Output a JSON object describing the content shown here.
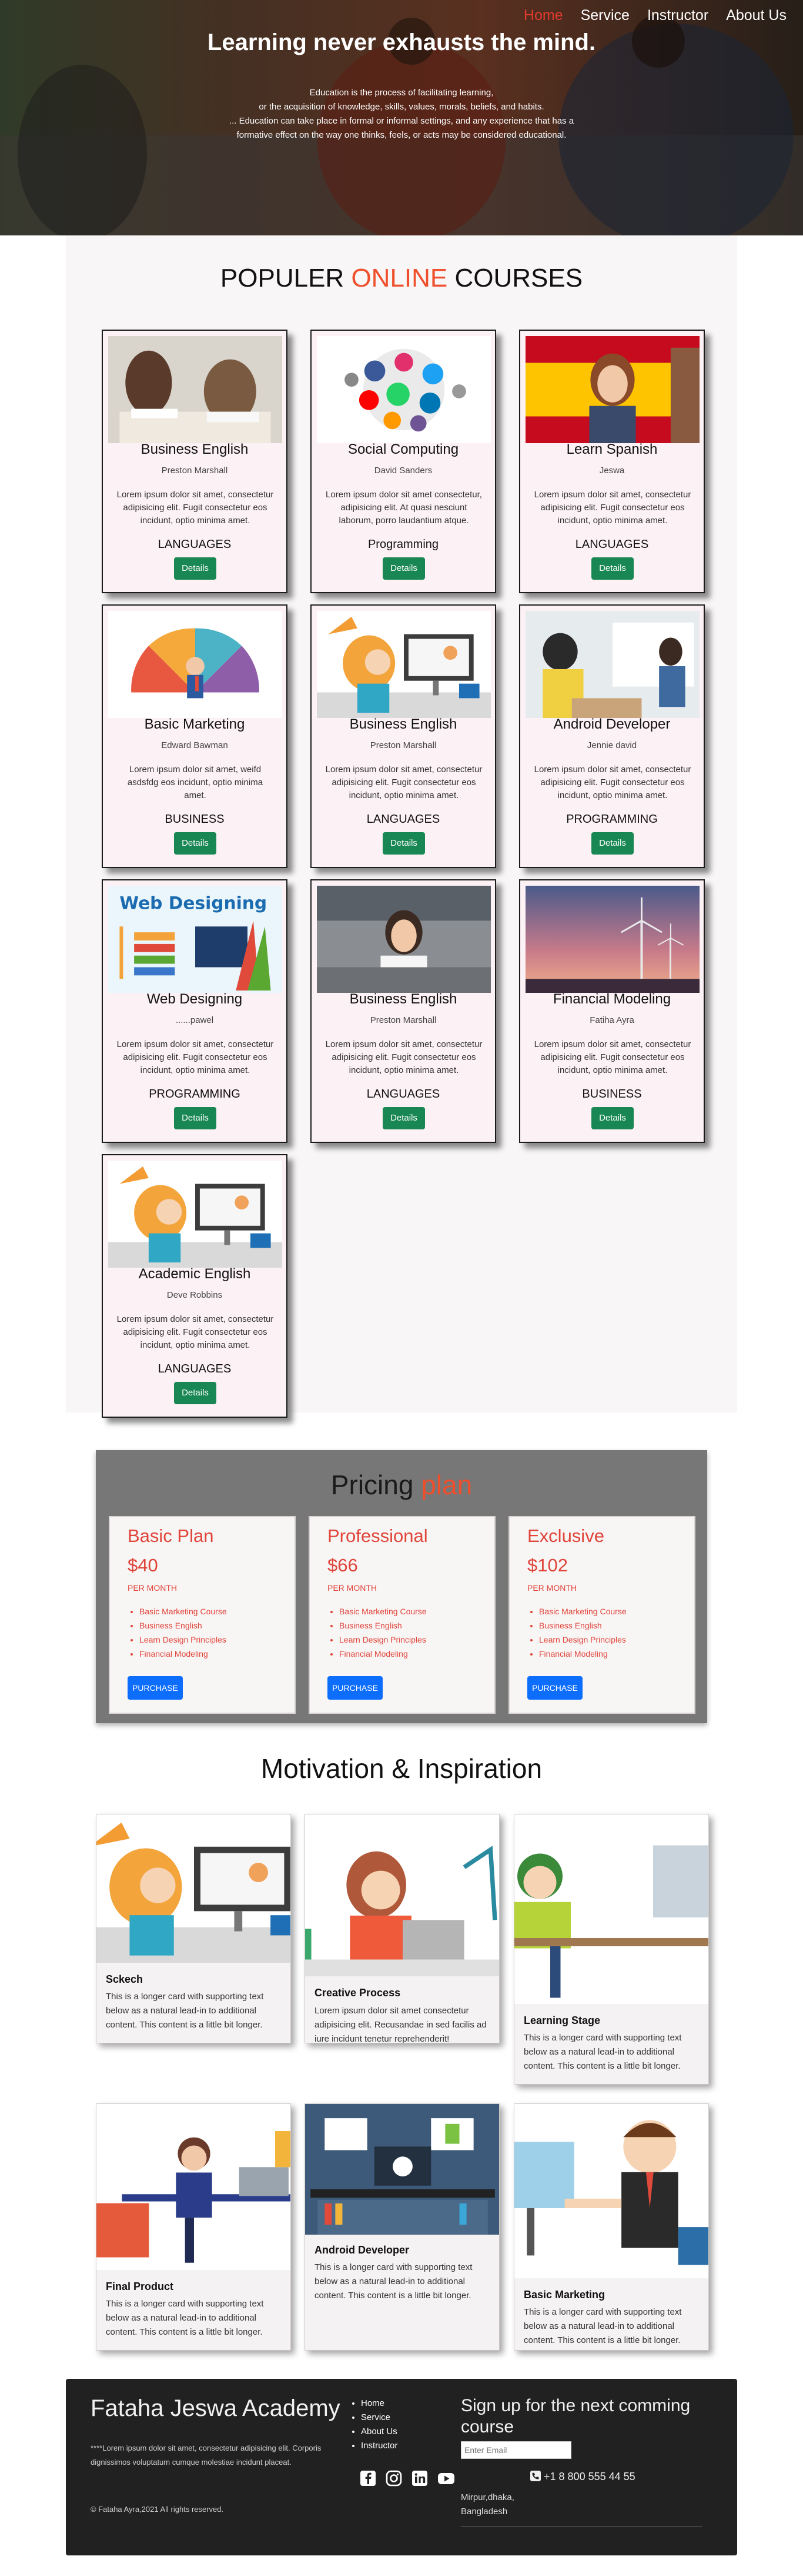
{
  "nav": {
    "items": [
      {
        "label": "Home"
      },
      {
        "label": "Service"
      },
      {
        "label": "Instructor"
      },
      {
        "label": "About Us"
      }
    ]
  },
  "hero": {
    "title": "Learning never exhausts the mind.",
    "line1": "Education is the process of facilitating learning,",
    "line2": "or the acquisition of knowledge, skills, values, morals, beliefs, and habits.",
    "line3": "... Education can take place in formal or informal settings, and any experience that has a",
    "line4": "formative effect on the way one thinks, feels, or acts may be considered educational."
  },
  "courses": {
    "title_part1": "POPULER",
    "title_accent": "ONLINE",
    "title_part2": "COURSES",
    "details_label": "Details",
    "items": [
      {
        "title": "Business English",
        "instructor": "Preston Marshall",
        "desc": "Lorem ipsum dolor sit amet, consectetur adipisicing elit. Fugit consectetur eos incidunt, optio minima amet.",
        "category": "LANGUAGES",
        "image": "students-studying-image"
      },
      {
        "title": "Social Computing",
        "instructor": "David Sanders",
        "desc": "Lorem ipsum dolor sit amet consectetur, adipisicing elit. At quasi nesciunt laborum, porro laudantium atque.",
        "category": "Programming",
        "image": "social-media-icons-image"
      },
      {
        "title": "Learn Spanish",
        "instructor": "Jeswa",
        "desc": "Lorem ipsum dolor sit amet, consectetur adipisicing elit. Fugit consectetur eos incidunt, optio minima amet.",
        "category": "LANGUAGES",
        "image": "spanish-flag-woman-image"
      },
      {
        "title": "Basic Marketing",
        "instructor": "Edward Bawman",
        "desc": "Lorem ipsum dolor sit amet, weifd asdsfdg eos incidunt, optio minima amet.",
        "category": "BUSINESS",
        "image": "marketing-wheel-image"
      },
      {
        "title": "Business English",
        "instructor": "Preston Marshall",
        "desc": "Lorem ipsum dolor sit amet, consectetur adipisicing elit. Fugit consectetur eos incidunt, optio minima amet.",
        "category": "LANGUAGES",
        "image": "girl-computer-illustration"
      },
      {
        "title": "Android Developer",
        "instructor": "Jennie david",
        "desc": "Lorem ipsum dolor sit amet, consectetur adipisicing elit. Fugit consectetur eos incidunt, optio minima amet.",
        "category": "PROGRAMMING",
        "image": "students-whiteboard-image"
      },
      {
        "title": "Web Designing",
        "instructor": "......pawel",
        "desc": "Lorem ipsum dolor sit amet, consectetur adipisicing elit. Fugit consectetur eos incidunt, optio minima amet.",
        "category": "PROGRAMMING",
        "image": "web-designing-banner"
      },
      {
        "title": "Business English",
        "instructor": "Preston Marshall",
        "desc": "Lorem ipsum dolor sit amet, consectetur adipisicing elit. Fugit consectetur eos incidunt, optio minima amet.",
        "category": "LANGUAGES",
        "image": "woman-office-image"
      },
      {
        "title": "Financial Modeling",
        "instructor": "Fatiha Ayra",
        "desc": "Lorem ipsum dolor sit amet, consectetur adipisicing elit. Fugit consectetur eos incidunt, optio minima amet.",
        "category": "BUSINESS",
        "image": "wind-turbines-image"
      },
      {
        "title": "Academic English",
        "instructor": "Deve Robbins",
        "desc": "Lorem ipsum dolor sit amet, consectetur adipisicing elit. Fugit consectetur eos incidunt, optio minima amet.",
        "category": "LANGUAGES",
        "image": "girl-computer-illustration"
      }
    ]
  },
  "pricing": {
    "title": "Pricing",
    "title_accent": "plan",
    "purchase_label": "PURCHASE",
    "plans": [
      {
        "name": "Basic Plan",
        "price": "$40",
        "period": "PER MONTH",
        "features": [
          "Basic Marketing Course",
          "Business English",
          "Learn Design Principles",
          "Financial Modeling"
        ]
      },
      {
        "name": "Professional",
        "price": "$66",
        "period": "PER MONTH",
        "features": [
          "Basic Marketing Course",
          "Business English",
          "Learn Design Principles",
          "Financial Modeling"
        ]
      },
      {
        "name": "Exclusive",
        "price": "$102",
        "period": "PER MONTH",
        "features": [
          "Basic Marketing Course",
          "Business English",
          "Learn Design Principles",
          "Financial Modeling"
        ]
      }
    ]
  },
  "motivation": {
    "title": "Motivation & Inspiration",
    "cards": [
      {
        "title": "Sckech",
        "desc": "This is a longer card with supporting text below as a natural lead-in to additional content. This content is a little bit longer.",
        "image": "girl-computer-illustration"
      },
      {
        "title": "Creative Process",
        "desc": "Lorem ipsum dolor sit amet consectetur adipisicing elit. Recusandae in sed facilis ad iure incidunt tenetur reprehenderit!",
        "image": "girl-laptop-illustration"
      },
      {
        "title": "Learning Stage",
        "desc": "This is a longer card with supporting text below as a natural lead-in to additional content. This content is a little bit longer.",
        "image": "girl-desk-illustration"
      },
      {
        "title": "Final Product",
        "desc": "This is a longer card with supporting text below as a natural lead-in to additional content. This content is a little bit longer.",
        "image": "man-desk-illustration"
      },
      {
        "title": "Android Developer",
        "desc": "This is a longer card with supporting text below as a natural lead-in to additional content. This content is a little bit longer.",
        "image": "developer-workspace-illustration"
      },
      {
        "title": "Basic Marketing",
        "desc": "This is a longer card with supporting text below as a natural lead-in to additional content. This content is a little bit longer.",
        "image": "businessman-illustration"
      }
    ]
  },
  "footer": {
    "brand": "Fataha Jeswa Academy",
    "desc": "****Lorem ipsum dolor sit amet, consectetur adipisicing elit. Corporis dignissimos voluptatum cumque molestiae incidunt placeat.",
    "copyright": "© Fataha Ayra,2021 All rights reserved.",
    "links": [
      "Home",
      "Service",
      "About Us",
      "Instructor"
    ],
    "signup_title": "Sign up for the next comming course",
    "email_placeholder": "Enter Email",
    "phone": "+1 8 800 555 44 55",
    "address_line1": "Mirpur,dhaka,",
    "address_line2": "Bangladesh",
    "socials": [
      "facebook-icon",
      "instagram-icon",
      "linkedin-icon",
      "youtube-icon"
    ]
  },
  "colors": {
    "accent": "#ef4f2c",
    "plan_text": "#e0453a",
    "details_button": "#198754",
    "purchase_button": "#0d6efd",
    "nav_active": "#e23a2d"
  }
}
